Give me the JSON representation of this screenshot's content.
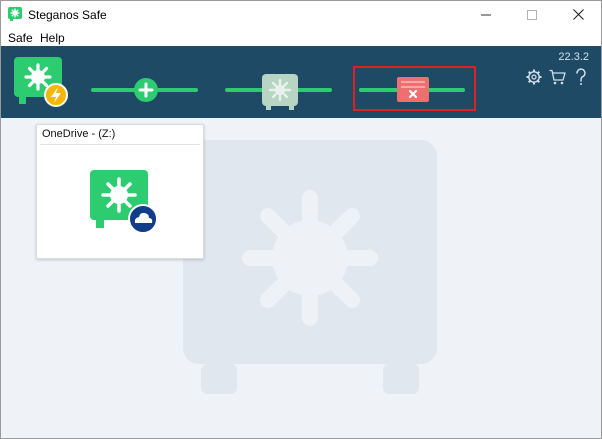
{
  "window": {
    "title": "Steganos Safe"
  },
  "menu": {
    "items": [
      "Safe",
      "Help"
    ]
  },
  "toolbar": {
    "version": "22.3.2"
  },
  "safes": [
    {
      "label": "OneDrive - (Z:)"
    }
  ],
  "colors": {
    "brand_green": "#2ecc71",
    "toolbar_bg": "#1f4a66",
    "content_bg": "#eff3f7",
    "delete_red": "#ee6f6f",
    "highlight": "#e02020",
    "onedrive_blue": "#0f3d8a"
  },
  "icons": [
    "safe-app-icon",
    "minimize-icon",
    "maximize-icon",
    "close-icon",
    "safe-lightning-icon",
    "add-safe-icon",
    "open-safe-icon",
    "delete-safe-icon",
    "gear-icon",
    "cart-icon",
    "help-icon",
    "onedrive-safe-icon",
    "cloud-badge-icon",
    "watermark-safe-icon"
  ]
}
